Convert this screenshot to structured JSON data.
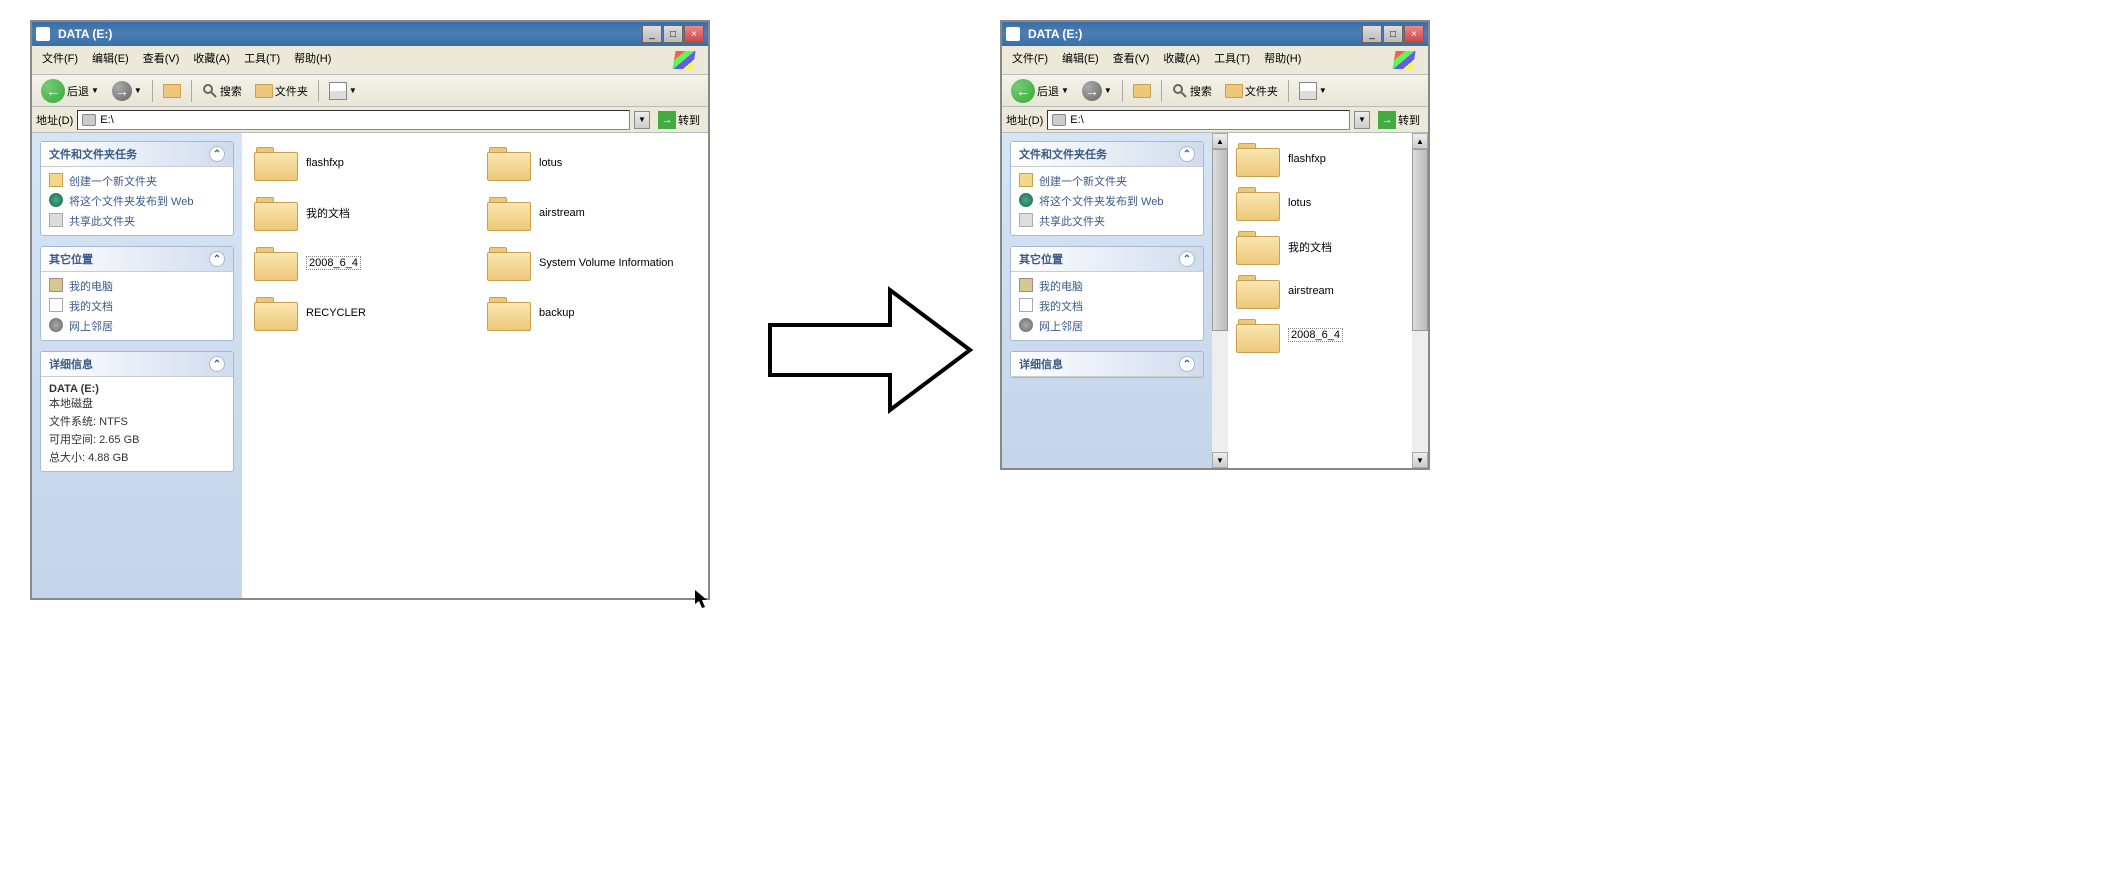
{
  "title": "DATA (E:)",
  "menu": {
    "file": "文件(F)",
    "edit": "编辑(E)",
    "view": "查看(V)",
    "favorites": "收藏(A)",
    "tools": "工具(T)",
    "help": "帮助(H)"
  },
  "toolbar": {
    "back": "后退",
    "search": "搜索",
    "folders": "文件夹"
  },
  "addressbar": {
    "label": "地址(D)",
    "path": "E:\\",
    "go": "转到"
  },
  "sidepanel": {
    "tasks": {
      "header": "文件和文件夹任务",
      "new_folder": "创建一个新文件夹",
      "publish_web": "将这个文件夹发布到 Web",
      "share": "共享此文件夹"
    },
    "places": {
      "header": "其它位置",
      "my_computer": "我的电脑",
      "my_documents": "我的文档",
      "network": "网上邻居"
    },
    "details": {
      "header": "详细信息",
      "name": "DATA (E:)",
      "type": "本地磁盘",
      "filesystem_label": "文件系统:",
      "filesystem_value": "NTFS",
      "free_label": "可用空间:",
      "free_value": "2.65 GB",
      "total_label": "总大小:",
      "total_value": "4.88 GB"
    }
  },
  "folders_left": [
    [
      "flashfxp",
      "lotus"
    ],
    [
      "我的文档",
      "airstream"
    ],
    [
      "2008_6_4",
      "System Volume Information"
    ],
    [
      "RECYCLER",
      "backup"
    ]
  ],
  "folders_right": [
    "flashfxp",
    "lotus",
    "我的文档",
    "airstream",
    "2008_6_4"
  ]
}
